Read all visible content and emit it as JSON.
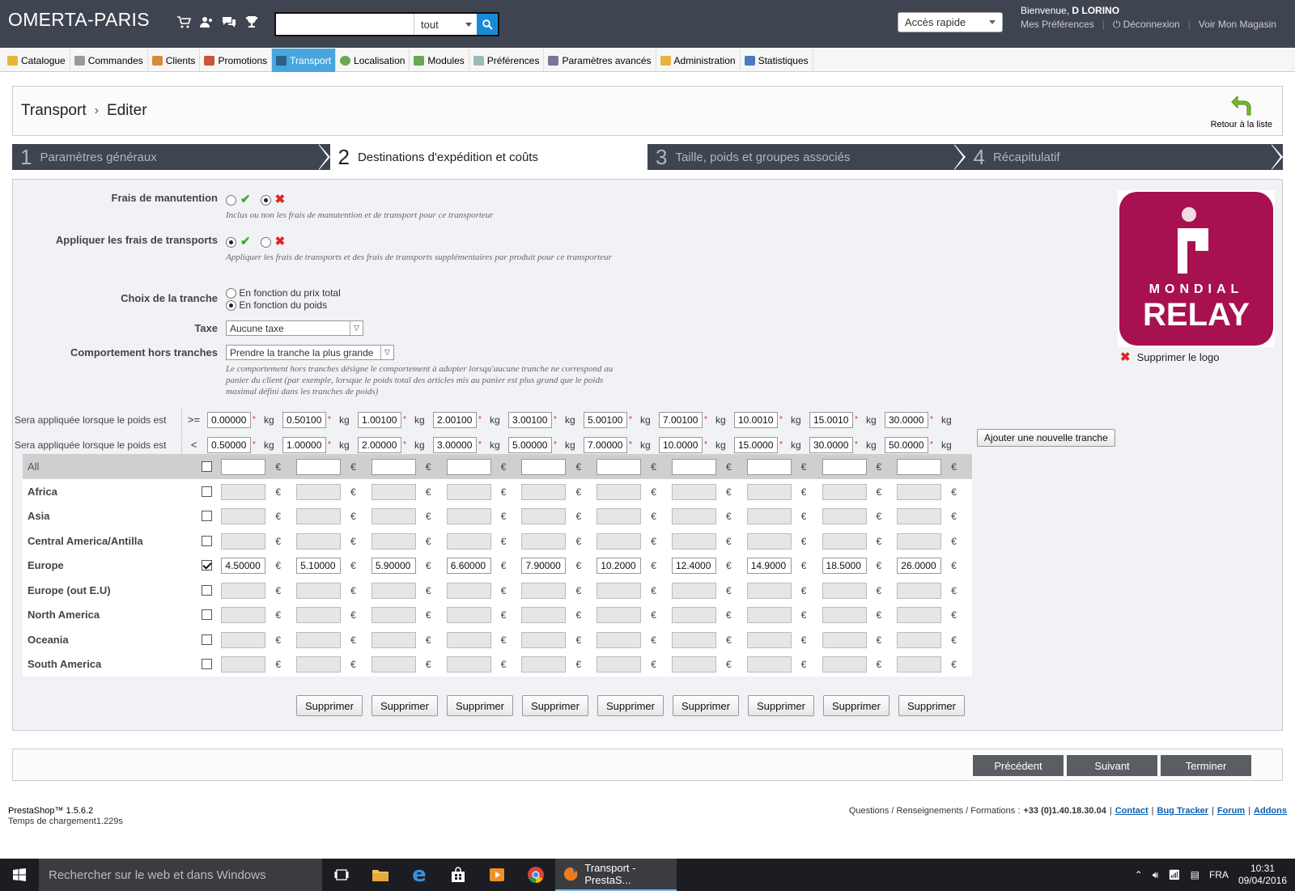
{
  "header": {
    "shop_name": "OMERTA-PARIS",
    "search_value": "",
    "search_scope": "tout",
    "quick_access": "Accès rapide",
    "welcome_prefix": "Bienvenue,",
    "user": "D LORINO",
    "links": [
      "Mes Préférences",
      "Déconnexion",
      "Voir Mon Magasin"
    ]
  },
  "menu": [
    {
      "label": "Catalogue",
      "color": "#e8b33c"
    },
    {
      "label": "Commandes",
      "color": "#888"
    },
    {
      "label": "Clients",
      "color": "#d9893a"
    },
    {
      "label": "Promotions",
      "color": "#c8553a"
    },
    {
      "label": "Transport",
      "color": "#5a6c7a"
    },
    {
      "label": "Localisation",
      "color": "#6aa84f"
    },
    {
      "label": "Modules",
      "color": "#6aa84f"
    },
    {
      "label": "Préférences",
      "color": "#8aa"
    },
    {
      "label": "Paramètres avancés",
      "color": "#668"
    },
    {
      "label": "Administration",
      "color": "#e8b33c"
    },
    {
      "label": "Statistiques",
      "color": "#4a78c2"
    }
  ],
  "breadcrumb": {
    "section": "Transport",
    "page": "Editer"
  },
  "back_label": "Retour à la liste",
  "steps": [
    {
      "num": "1",
      "label": "Paramètres généraux"
    },
    {
      "num": "2",
      "label": "Destinations d'expédition et coûts"
    },
    {
      "num": "3",
      "label": "Taille, poids et groupes associés"
    },
    {
      "num": "4",
      "label": "Récapitulatif"
    }
  ],
  "form": {
    "handling": {
      "label": "Frais de manutention",
      "hint": "Inclus ou non les frais de manutention et de transport pour ce transporteur"
    },
    "apply_shipping": {
      "label": "Appliquer les frais de transports",
      "hint": "Appliquer les frais de transports et des frais de transports supplémentaires par produit pour ce transporteur"
    },
    "billing": {
      "label": "Choix de la tranche",
      "option1": "En fonction du prix total",
      "option2": "En fonction du poids"
    },
    "tax": {
      "label": "Taxe",
      "value": "Aucune taxe"
    },
    "out_of_range": {
      "label": "Comportement hors tranches",
      "value": "Prendre la tranche la plus grande",
      "hint": "Le comportement hors tranches désigne le comportement à adopter lorsqu'aucune tranche ne correspond au panier du client (par exemple, lorsque le poids total des articles mis au panier est plus grand que le poids maximal défini dans les tranches de poids)"
    },
    "logo_brand_top": "MONDIAL",
    "logo_brand_bottom": "RELAY",
    "delete_logo": "Supprimer le logo"
  },
  "ranges": {
    "label": "Sera appliquée lorsque le poids est",
    "op_min": ">=",
    "op_max": "<",
    "unit": "kg",
    "min": [
      "0.00000",
      "0.50100",
      "1.00100",
      "2.00100",
      "3.00100",
      "5.00100",
      "7.00100",
      "10.0010",
      "15.0010",
      "30.0000"
    ],
    "max": [
      "0.50000",
      "1.00000",
      "2.00000",
      "3.00000",
      "5.00000",
      "7.00000",
      "10.0000",
      "15.0000",
      "30.0000",
      "50.0000"
    ],
    "add_button": "Ajouter une nouvelle tranche"
  },
  "currency": "€",
  "zones": [
    {
      "name": "All",
      "checked": false,
      "prices": []
    },
    {
      "name": "Africa",
      "checked": false,
      "prices": []
    },
    {
      "name": "Asia",
      "checked": false,
      "prices": []
    },
    {
      "name": "Central America/Antilla",
      "checked": false,
      "prices": []
    },
    {
      "name": "Europe",
      "checked": true,
      "prices": [
        "4.50000",
        "5.10000",
        "5.90000",
        "6.60000",
        "7.90000",
        "10.2000",
        "12.4000",
        "14.9000",
        "18.5000",
        "26.0000"
      ]
    },
    {
      "name": "Europe (out E.U)",
      "checked": false,
      "prices": []
    },
    {
      "name": "North America",
      "checked": false,
      "prices": []
    },
    {
      "name": "Oceania",
      "checked": false,
      "prices": []
    },
    {
      "name": "South America",
      "checked": false,
      "prices": []
    }
  ],
  "delete_label": "Supprimer",
  "nav": {
    "prev": "Précédent",
    "next": "Suivant",
    "finish": "Terminer"
  },
  "footer": {
    "version": "PrestaShop™ 1.5.6.2",
    "load_time": "Temps de chargement1.229s",
    "support_text": "Questions / Renseignements / Formations :",
    "phone": "+33 (0)1.40.18.30.04",
    "links": [
      "Contact",
      "Bug Tracker",
      "Forum",
      "Addons"
    ]
  },
  "taskbar": {
    "search_placeholder": "Rechercher sur le web et dans Windows",
    "active_window": "Transport - PrestaS...",
    "lang": "FRA",
    "time": "10:31",
    "date": "09/04/2016"
  }
}
